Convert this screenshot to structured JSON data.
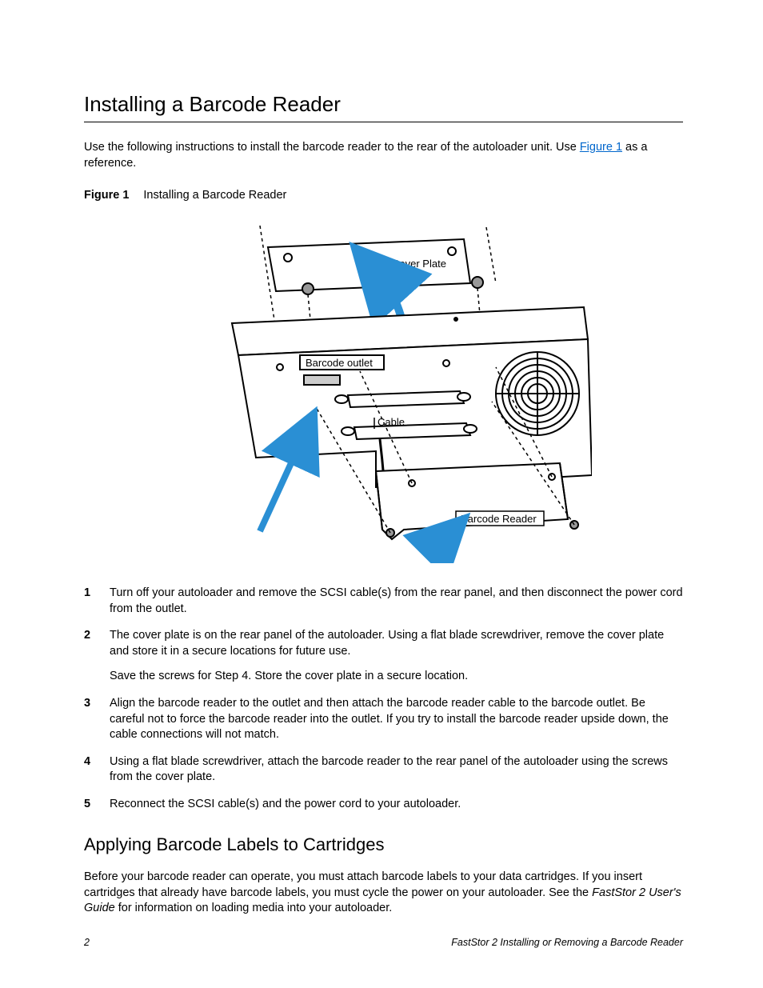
{
  "heading1": "Installing a Barcode Reader",
  "intro_part1": "Use the following instructions to install the barcode reader to the rear of the autoloader unit. Use ",
  "intro_link": "Figure 1",
  "intro_part2": " as a reference.",
  "figure": {
    "label": "Figure 1",
    "caption": "Installing a Barcode Reader",
    "labels": {
      "cover_plate": "Cover Plate",
      "barcode_outlet": "Barcode outlet",
      "cable": "Cable",
      "barcode_reader": "Barcode Reader"
    }
  },
  "steps": [
    {
      "text": "Turn off your autoloader and remove the SCSI cable(s) from the rear panel, and then disconnect the power cord from the outlet."
    },
    {
      "text": "The cover plate is on the rear panel of the autoloader. Using a flat blade screwdriver, remove the cover plate and store it in a secure locations for future use.",
      "sub": "Save the screws for Step 4. Store the cover plate in a secure location."
    },
    {
      "text": "Align the barcode reader to the outlet and then attach the barcode reader cable to the barcode outlet. Be careful not to force the barcode reader into the outlet. If you try to install the barcode reader upside down, the cable connections will not match."
    },
    {
      "text": "Using a flat blade screwdriver, attach the barcode reader to the rear panel of the autoloader using the screws from the cover plate."
    },
    {
      "text": "Reconnect the SCSI cable(s) and the power cord to your autoloader."
    }
  ],
  "heading2": "Applying Barcode Labels to Cartridges",
  "body2_part1": "Before your barcode reader can operate, you must attach barcode labels to your data cartridges. If you insert cartridges that already have barcode labels, you must cycle the power on your autoloader. See the ",
  "body2_italic": "FastStor 2 User's Guide",
  "body2_part2": " for information on loading media into your autoloader.",
  "footer": {
    "page": "2",
    "title": "FastStor 2 Installing or Removing a Barcode Reader"
  }
}
